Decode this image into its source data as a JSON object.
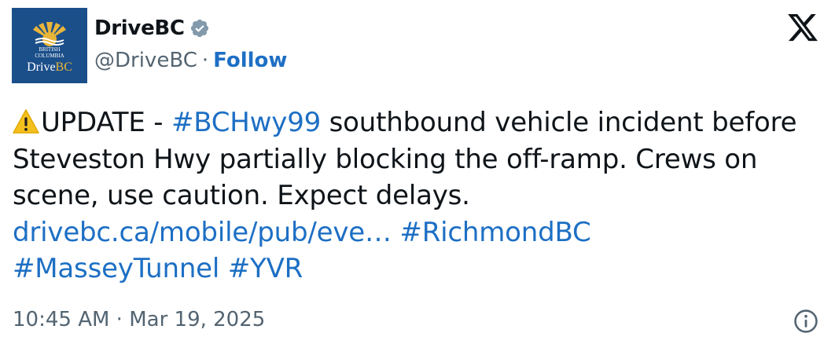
{
  "author": {
    "display_name": "DriveBC",
    "handle": "@DriveBC",
    "separator": "·",
    "follow_label": "Follow",
    "avatar": {
      "line1": "BRITISH",
      "line2": "COLUMBIA",
      "brand_prefix": "Drive",
      "brand_suffix": "BC",
      "background": "#1b4f8a",
      "accent": "#e8b53a"
    },
    "verified_icon": "verified-badge-icon"
  },
  "platform_icon": "x-logo-icon",
  "tweet": {
    "warning_icon": "warning-icon",
    "t1": "UPDATE - ",
    "h1": "#BCHwy99",
    "t2": " southbound vehicle incident before Steveston Hwy partially blocking the off-ramp. Crews on scene, use caution. Expect delays.",
    "url": "drivebc.ca/mobile/pub/eve…",
    "h2": "#RichmondBC",
    "h3": "#MasseyTunnel",
    "h4": "#YVR"
  },
  "footer": {
    "timestamp": "10:45 AM · Mar 19, 2025",
    "info_icon": "info-icon"
  },
  "colors": {
    "text": "#0f1419",
    "muted": "#536471",
    "link": "#1d6fc4",
    "verified": "#829aab"
  }
}
